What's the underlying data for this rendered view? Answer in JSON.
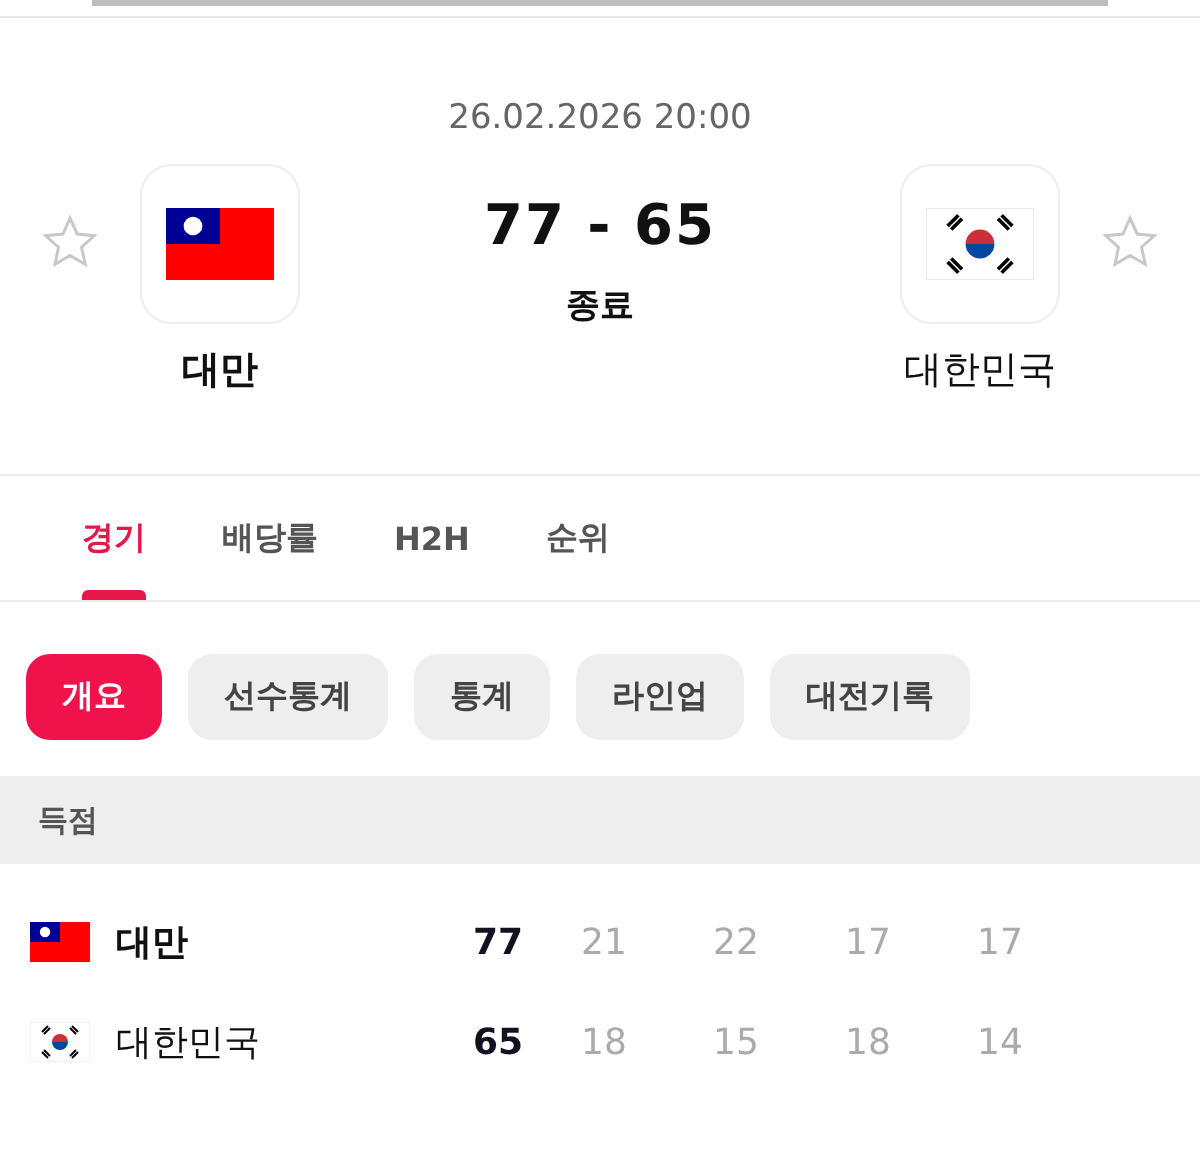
{
  "match": {
    "datetime": "26.02.2026 20:00",
    "score": "77 - 65",
    "status": "종료",
    "home": {
      "name": "대만",
      "kind": "tw",
      "favorite": false
    },
    "away": {
      "name": "대한민국",
      "kind": "kr",
      "favorite": false
    }
  },
  "tabs": [
    {
      "label": "경기",
      "selected": true
    },
    {
      "label": "배당률",
      "selected": false
    },
    {
      "label": "H2H",
      "selected": false
    },
    {
      "label": "순위",
      "selected": false
    }
  ],
  "chips": [
    {
      "label": "개요",
      "selected": true
    },
    {
      "label": "선수통계",
      "selected": false
    },
    {
      "label": "통계",
      "selected": false
    },
    {
      "label": "라인업",
      "selected": false
    },
    {
      "label": "대전기록",
      "selected": false
    }
  ],
  "scoring": {
    "title": "득점",
    "rows": [
      {
        "team": "대만",
        "kind": "tw",
        "winner": true,
        "total": "77",
        "quarters": [
          "21",
          "22",
          "17",
          "17"
        ]
      },
      {
        "team": "대한민국",
        "kind": "kr",
        "winner": false,
        "total": "65",
        "quarters": [
          "18",
          "15",
          "18",
          "14"
        ]
      }
    ]
  }
}
